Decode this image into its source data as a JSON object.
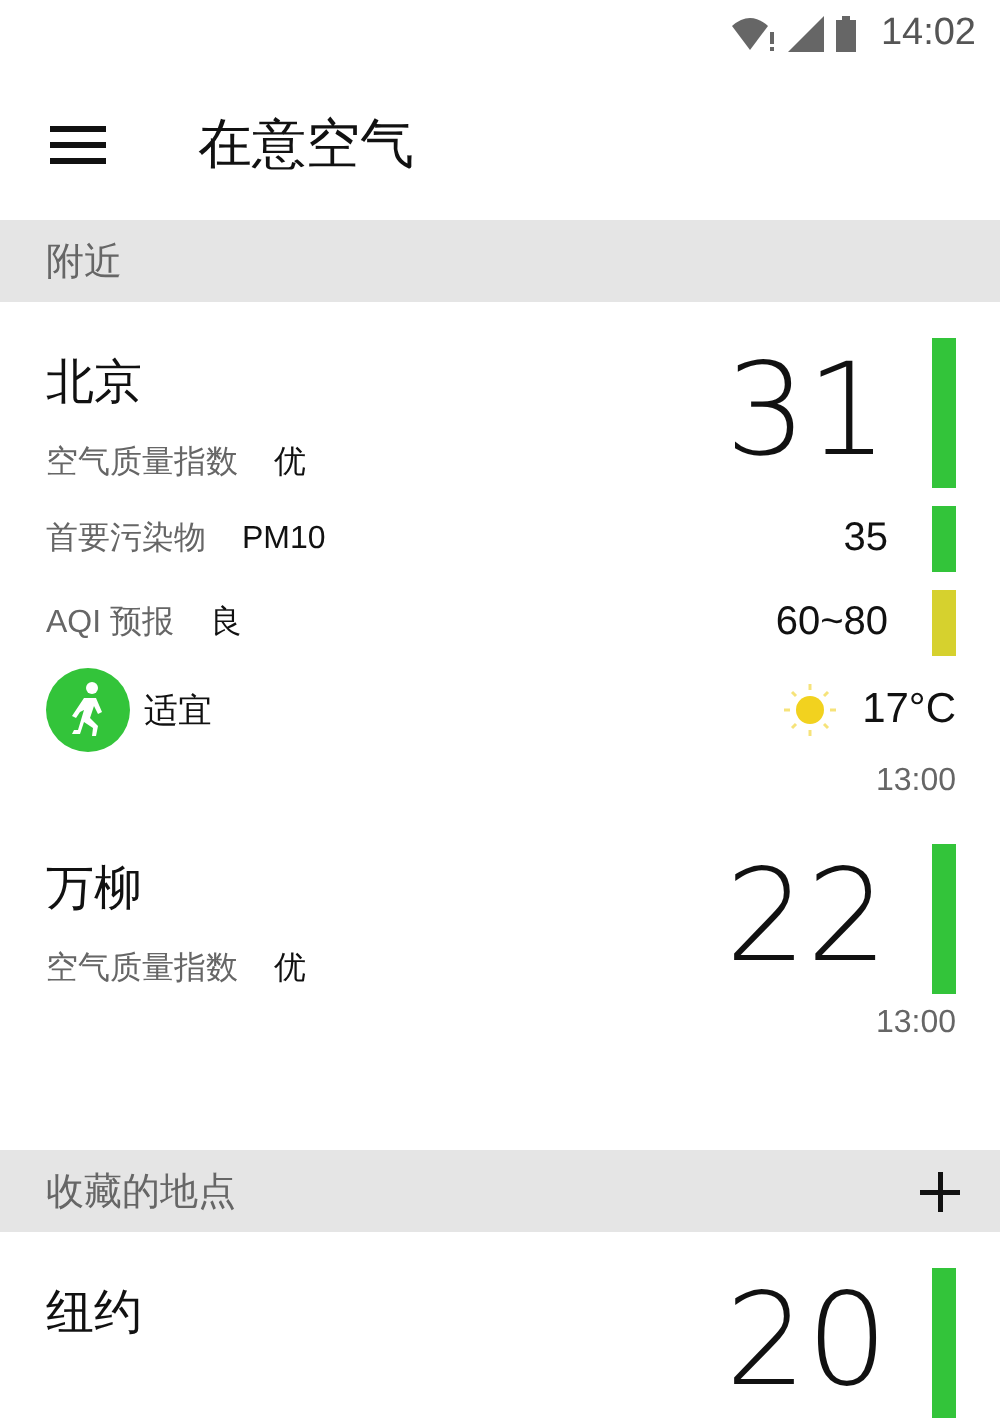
{
  "status_bar": {
    "time": "14:02"
  },
  "app_bar": {
    "title": "在意空气"
  },
  "sections": [
    {
      "title": "附近",
      "add_button": false,
      "places": [
        {
          "name": "北京",
          "aqi": "31",
          "color": "#33c43a",
          "time": "13:00",
          "rows": [
            {
              "kind": "index",
              "label": "空气质量指数",
              "value": "优"
            },
            {
              "kind": "measure",
              "label": "首要污染物",
              "value": "PM10",
              "number": "35",
              "color": "#33c43a"
            },
            {
              "kind": "measure",
              "label": "AQI 预报",
              "value": "良",
              "number": "60~80",
              "color": "#d6d12e"
            },
            {
              "kind": "conditions",
              "activity": "适宜",
              "temperature": "17°C"
            }
          ]
        },
        {
          "name": "万柳",
          "aqi": "22",
          "color": "#33c43a",
          "time": "13:00",
          "rows": [
            {
              "kind": "index",
              "label": "空气质量指数",
              "value": "优"
            }
          ]
        }
      ]
    },
    {
      "title": "收藏的地点",
      "add_button": true,
      "places": [
        {
          "name": "纽约",
          "aqi": "20",
          "color": "#33c43a"
        }
      ]
    }
  ]
}
